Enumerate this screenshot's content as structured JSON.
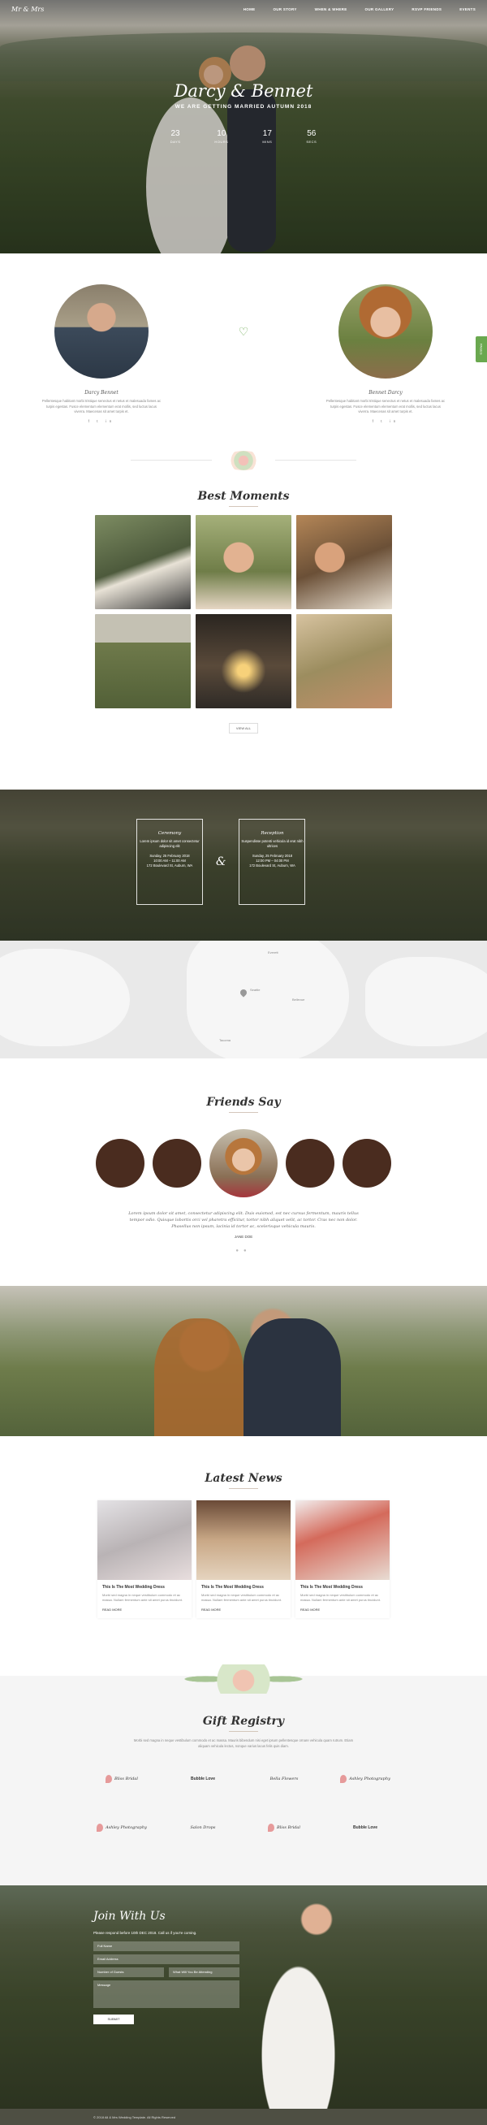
{
  "nav": {
    "logo": "Mr & Mrs",
    "items": [
      "HOME",
      "OUR STORY",
      "WHEN & WHERE",
      "OUR GALLERY",
      "RSVP FRIENDS",
      "EVENTS"
    ]
  },
  "hero": {
    "title": "Darcy & Bennet",
    "tagline": "WE ARE GETTING MARRIED AUTUMN 2018",
    "countdown": [
      {
        "value": "23",
        "label": "DAYS"
      },
      {
        "value": "10",
        "label": "HOURS"
      },
      {
        "value": "17",
        "label": "MINS"
      },
      {
        "value": "56",
        "label": "SECS"
      }
    ]
  },
  "side_tab": "PAGES",
  "couple": {
    "groom": {
      "name": "Darcy Bennet",
      "bio": "Pellentesque habitant morbi tristique senectus et netus et malesuada fames ac turpis egestas. Fusce elementum elementum erat mollis, sed luctus lacus viverra. Maecenas sit amet turpis et.",
      "social": "f  t  in"
    },
    "bride": {
      "name": "Bennet Darcy",
      "bio": "Pellentesque habitant morbi tristique senectus et netus et malesuada fames ac turpis egestas. Fusce elementum elementum erat mollis, sed luctus lacus viverra. Maecenas sit amet turpis et.",
      "social": "f  t  in"
    }
  },
  "moments": {
    "title": "Best Moments",
    "view_all": "VIEW ALL"
  },
  "events": {
    "ceremony": {
      "title": "Ceremony",
      "subtitle": "Lorem ipsum dolor sit amet consectetur adipiscing elit",
      "date": "Sunday, 25 February 2018",
      "time": "10:00 AM – 11:00 AM",
      "address": "172 Boulevard St, Auburn, WA"
    },
    "reception": {
      "title": "Reception",
      "subtitle": "Suspendisse potenti vehicula id erat nibh ultrices",
      "date": "Sunday, 25 February 2018",
      "time": "12:00 PM – 04:00 PM",
      "address": "172 Boulevard St, Auburn, WA"
    }
  },
  "map": {
    "cities": [
      "Seattle",
      "Bellevue",
      "Tacoma",
      "Everett"
    ]
  },
  "friends": {
    "title": "Friends Say",
    "quote": "Lorem ipsum dolor sit amet, consectetur adipiscing elit. Duis euismod, est nec cursus fermentum, mauris tellus tempor odio. Quisque lobortis orci vel pharetra efficitur, tortor nibh aliquet velit, ac tortor. Cras nec non dolor. Phasellus non ipsum, lacinia id tortor ac, scelerisque vehicula mauris.",
    "name": "JANE DOE"
  },
  "news": {
    "title": "Latest News",
    "cards": [
      {
        "title": "This Is The Most Wedding Dress",
        "text": "Morbi sed magna in neque vestibulum commodo et ac massa. Nullam fermentum ante sit amet purus tincidunt.",
        "more": "READ MORE"
      },
      {
        "title": "This Is The Most Wedding Dress",
        "text": "Morbi sed magna in neque vestibulum commodo et ac massa. Nullam fermentum ante sit amet purus tincidunt.",
        "more": "READ MORE"
      },
      {
        "title": "This Is The Most Wedding Dress",
        "text": "Morbi sed magna in neque vestibulum commodo et ac massa. Nullam fermentum ante sit amet purus tincidunt.",
        "more": "READ MORE"
      }
    ]
  },
  "registry": {
    "title": "Gift Registry",
    "text": "Morbi sed magna in neque vestibulum commodo et ac massa. Mauris bibendum nisi eget ipsum pellentesque ornare vehicula quam rutrum. Etiam aliquam vehicula lectus, nonque varius lacus felis quis diam.",
    "logos": [
      "Bliss Bridal",
      "Bubble Love",
      "Bella Flowers",
      "Ashley Photography",
      "Ashley Photography",
      "Salon Drops",
      "Bliss Bridal",
      "Bubble Love"
    ]
  },
  "join": {
    "title": "Join With Us",
    "subtitle": "Please respond before 10th DEC 2018. Call us if you're coming.",
    "fields": {
      "full_name": "Full Name",
      "email": "Email Address",
      "guests": "Number of Guests",
      "attending": "What Will You Be Attending",
      "message": "Message"
    },
    "submit": "SUBMIT"
  },
  "footer": {
    "text": "© 2018 All & Mrs Wedding Template. All Rights Reserved"
  }
}
